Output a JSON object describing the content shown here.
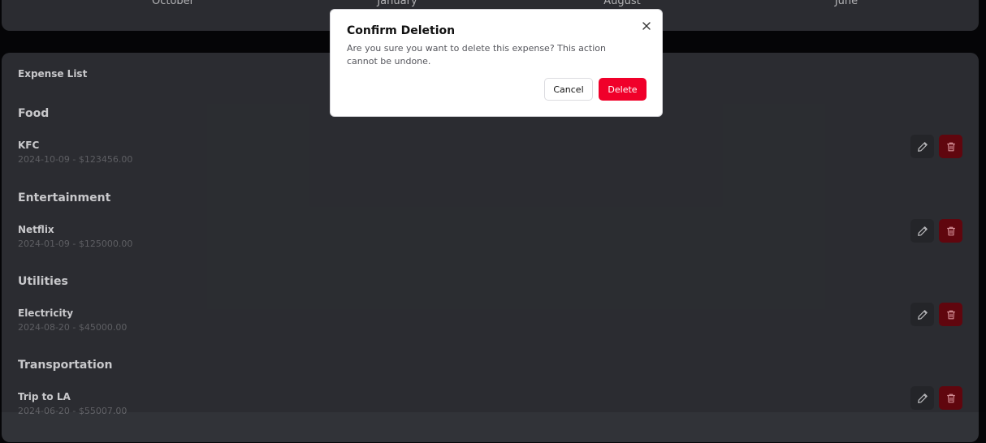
{
  "chart_months": [
    "October",
    "January",
    "August",
    "June"
  ],
  "expense_list": {
    "title": "Expense List",
    "groups": [
      {
        "category": "Food",
        "items": [
          {
            "name": "KFC",
            "meta": "2024-10-09 - $123456.00"
          }
        ]
      },
      {
        "category": "Entertainment",
        "items": [
          {
            "name": "Netflix",
            "meta": "2024-01-09 - $125000.00"
          }
        ]
      },
      {
        "category": "Utilities",
        "items": [
          {
            "name": "Electricity",
            "meta": "2024-08-20 - $45000.00"
          }
        ]
      },
      {
        "category": "Transportation",
        "items": [
          {
            "name": "Trip to LA",
            "meta": "2024-06-20 - $55007.00"
          }
        ]
      }
    ]
  },
  "icons": {
    "edit": "pencil-icon",
    "delete": "trash-icon",
    "close": "close-icon"
  },
  "colors": {
    "danger": "#f0002a",
    "danger_dark": "#6e0711",
    "card": "#313338"
  },
  "dialog": {
    "title": "Confirm Deletion",
    "message": "Are you sure you want to delete this expense? This action cannot be undone.",
    "cancel_label": "Cancel",
    "delete_label": "Delete"
  }
}
